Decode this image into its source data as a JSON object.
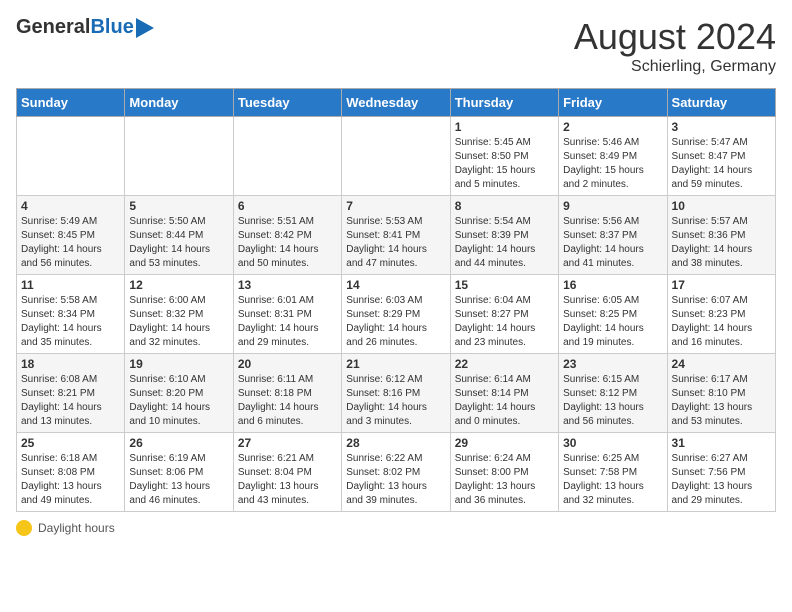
{
  "header": {
    "logo_general": "General",
    "logo_blue": "Blue",
    "month_year": "August 2024",
    "location": "Schierling, Germany"
  },
  "weekdays": [
    "Sunday",
    "Monday",
    "Tuesday",
    "Wednesday",
    "Thursday",
    "Friday",
    "Saturday"
  ],
  "footer": {
    "icon": "sun-icon",
    "label": "Daylight hours"
  },
  "weeks": [
    [
      {
        "day": "",
        "sunrise": "",
        "sunset": "",
        "daylight": ""
      },
      {
        "day": "",
        "sunrise": "",
        "sunset": "",
        "daylight": ""
      },
      {
        "day": "",
        "sunrise": "",
        "sunset": "",
        "daylight": ""
      },
      {
        "day": "",
        "sunrise": "",
        "sunset": "",
        "daylight": ""
      },
      {
        "day": "1",
        "sunrise": "Sunrise: 5:45 AM",
        "sunset": "Sunset: 8:50 PM",
        "daylight": "Daylight: 15 hours and 5 minutes."
      },
      {
        "day": "2",
        "sunrise": "Sunrise: 5:46 AM",
        "sunset": "Sunset: 8:49 PM",
        "daylight": "Daylight: 15 hours and 2 minutes."
      },
      {
        "day": "3",
        "sunrise": "Sunrise: 5:47 AM",
        "sunset": "Sunset: 8:47 PM",
        "daylight": "Daylight: 14 hours and 59 minutes."
      }
    ],
    [
      {
        "day": "4",
        "sunrise": "Sunrise: 5:49 AM",
        "sunset": "Sunset: 8:45 PM",
        "daylight": "Daylight: 14 hours and 56 minutes."
      },
      {
        "day": "5",
        "sunrise": "Sunrise: 5:50 AM",
        "sunset": "Sunset: 8:44 PM",
        "daylight": "Daylight: 14 hours and 53 minutes."
      },
      {
        "day": "6",
        "sunrise": "Sunrise: 5:51 AM",
        "sunset": "Sunset: 8:42 PM",
        "daylight": "Daylight: 14 hours and 50 minutes."
      },
      {
        "day": "7",
        "sunrise": "Sunrise: 5:53 AM",
        "sunset": "Sunset: 8:41 PM",
        "daylight": "Daylight: 14 hours and 47 minutes."
      },
      {
        "day": "8",
        "sunrise": "Sunrise: 5:54 AM",
        "sunset": "Sunset: 8:39 PM",
        "daylight": "Daylight: 14 hours and 44 minutes."
      },
      {
        "day": "9",
        "sunrise": "Sunrise: 5:56 AM",
        "sunset": "Sunset: 8:37 PM",
        "daylight": "Daylight: 14 hours and 41 minutes."
      },
      {
        "day": "10",
        "sunrise": "Sunrise: 5:57 AM",
        "sunset": "Sunset: 8:36 PM",
        "daylight": "Daylight: 14 hours and 38 minutes."
      }
    ],
    [
      {
        "day": "11",
        "sunrise": "Sunrise: 5:58 AM",
        "sunset": "Sunset: 8:34 PM",
        "daylight": "Daylight: 14 hours and 35 minutes."
      },
      {
        "day": "12",
        "sunrise": "Sunrise: 6:00 AM",
        "sunset": "Sunset: 8:32 PM",
        "daylight": "Daylight: 14 hours and 32 minutes."
      },
      {
        "day": "13",
        "sunrise": "Sunrise: 6:01 AM",
        "sunset": "Sunset: 8:31 PM",
        "daylight": "Daylight: 14 hours and 29 minutes."
      },
      {
        "day": "14",
        "sunrise": "Sunrise: 6:03 AM",
        "sunset": "Sunset: 8:29 PM",
        "daylight": "Daylight: 14 hours and 26 minutes."
      },
      {
        "day": "15",
        "sunrise": "Sunrise: 6:04 AM",
        "sunset": "Sunset: 8:27 PM",
        "daylight": "Daylight: 14 hours and 23 minutes."
      },
      {
        "day": "16",
        "sunrise": "Sunrise: 6:05 AM",
        "sunset": "Sunset: 8:25 PM",
        "daylight": "Daylight: 14 hours and 19 minutes."
      },
      {
        "day": "17",
        "sunrise": "Sunrise: 6:07 AM",
        "sunset": "Sunset: 8:23 PM",
        "daylight": "Daylight: 14 hours and 16 minutes."
      }
    ],
    [
      {
        "day": "18",
        "sunrise": "Sunrise: 6:08 AM",
        "sunset": "Sunset: 8:21 PM",
        "daylight": "Daylight: 14 hours and 13 minutes."
      },
      {
        "day": "19",
        "sunrise": "Sunrise: 6:10 AM",
        "sunset": "Sunset: 8:20 PM",
        "daylight": "Daylight: 14 hours and 10 minutes."
      },
      {
        "day": "20",
        "sunrise": "Sunrise: 6:11 AM",
        "sunset": "Sunset: 8:18 PM",
        "daylight": "Daylight: 14 hours and 6 minutes."
      },
      {
        "day": "21",
        "sunrise": "Sunrise: 6:12 AM",
        "sunset": "Sunset: 8:16 PM",
        "daylight": "Daylight: 14 hours and 3 minutes."
      },
      {
        "day": "22",
        "sunrise": "Sunrise: 6:14 AM",
        "sunset": "Sunset: 8:14 PM",
        "daylight": "Daylight: 14 hours and 0 minutes."
      },
      {
        "day": "23",
        "sunrise": "Sunrise: 6:15 AM",
        "sunset": "Sunset: 8:12 PM",
        "daylight": "Daylight: 13 hours and 56 minutes."
      },
      {
        "day": "24",
        "sunrise": "Sunrise: 6:17 AM",
        "sunset": "Sunset: 8:10 PM",
        "daylight": "Daylight: 13 hours and 53 minutes."
      }
    ],
    [
      {
        "day": "25",
        "sunrise": "Sunrise: 6:18 AM",
        "sunset": "Sunset: 8:08 PM",
        "daylight": "Daylight: 13 hours and 49 minutes."
      },
      {
        "day": "26",
        "sunrise": "Sunrise: 6:19 AM",
        "sunset": "Sunset: 8:06 PM",
        "daylight": "Daylight: 13 hours and 46 minutes."
      },
      {
        "day": "27",
        "sunrise": "Sunrise: 6:21 AM",
        "sunset": "Sunset: 8:04 PM",
        "daylight": "Daylight: 13 hours and 43 minutes."
      },
      {
        "day": "28",
        "sunrise": "Sunrise: 6:22 AM",
        "sunset": "Sunset: 8:02 PM",
        "daylight": "Daylight: 13 hours and 39 minutes."
      },
      {
        "day": "29",
        "sunrise": "Sunrise: 6:24 AM",
        "sunset": "Sunset: 8:00 PM",
        "daylight": "Daylight: 13 hours and 36 minutes."
      },
      {
        "day": "30",
        "sunrise": "Sunrise: 6:25 AM",
        "sunset": "Sunset: 7:58 PM",
        "daylight": "Daylight: 13 hours and 32 minutes."
      },
      {
        "day": "31",
        "sunrise": "Sunrise: 6:27 AM",
        "sunset": "Sunset: 7:56 PM",
        "daylight": "Daylight: 13 hours and 29 minutes."
      }
    ]
  ]
}
